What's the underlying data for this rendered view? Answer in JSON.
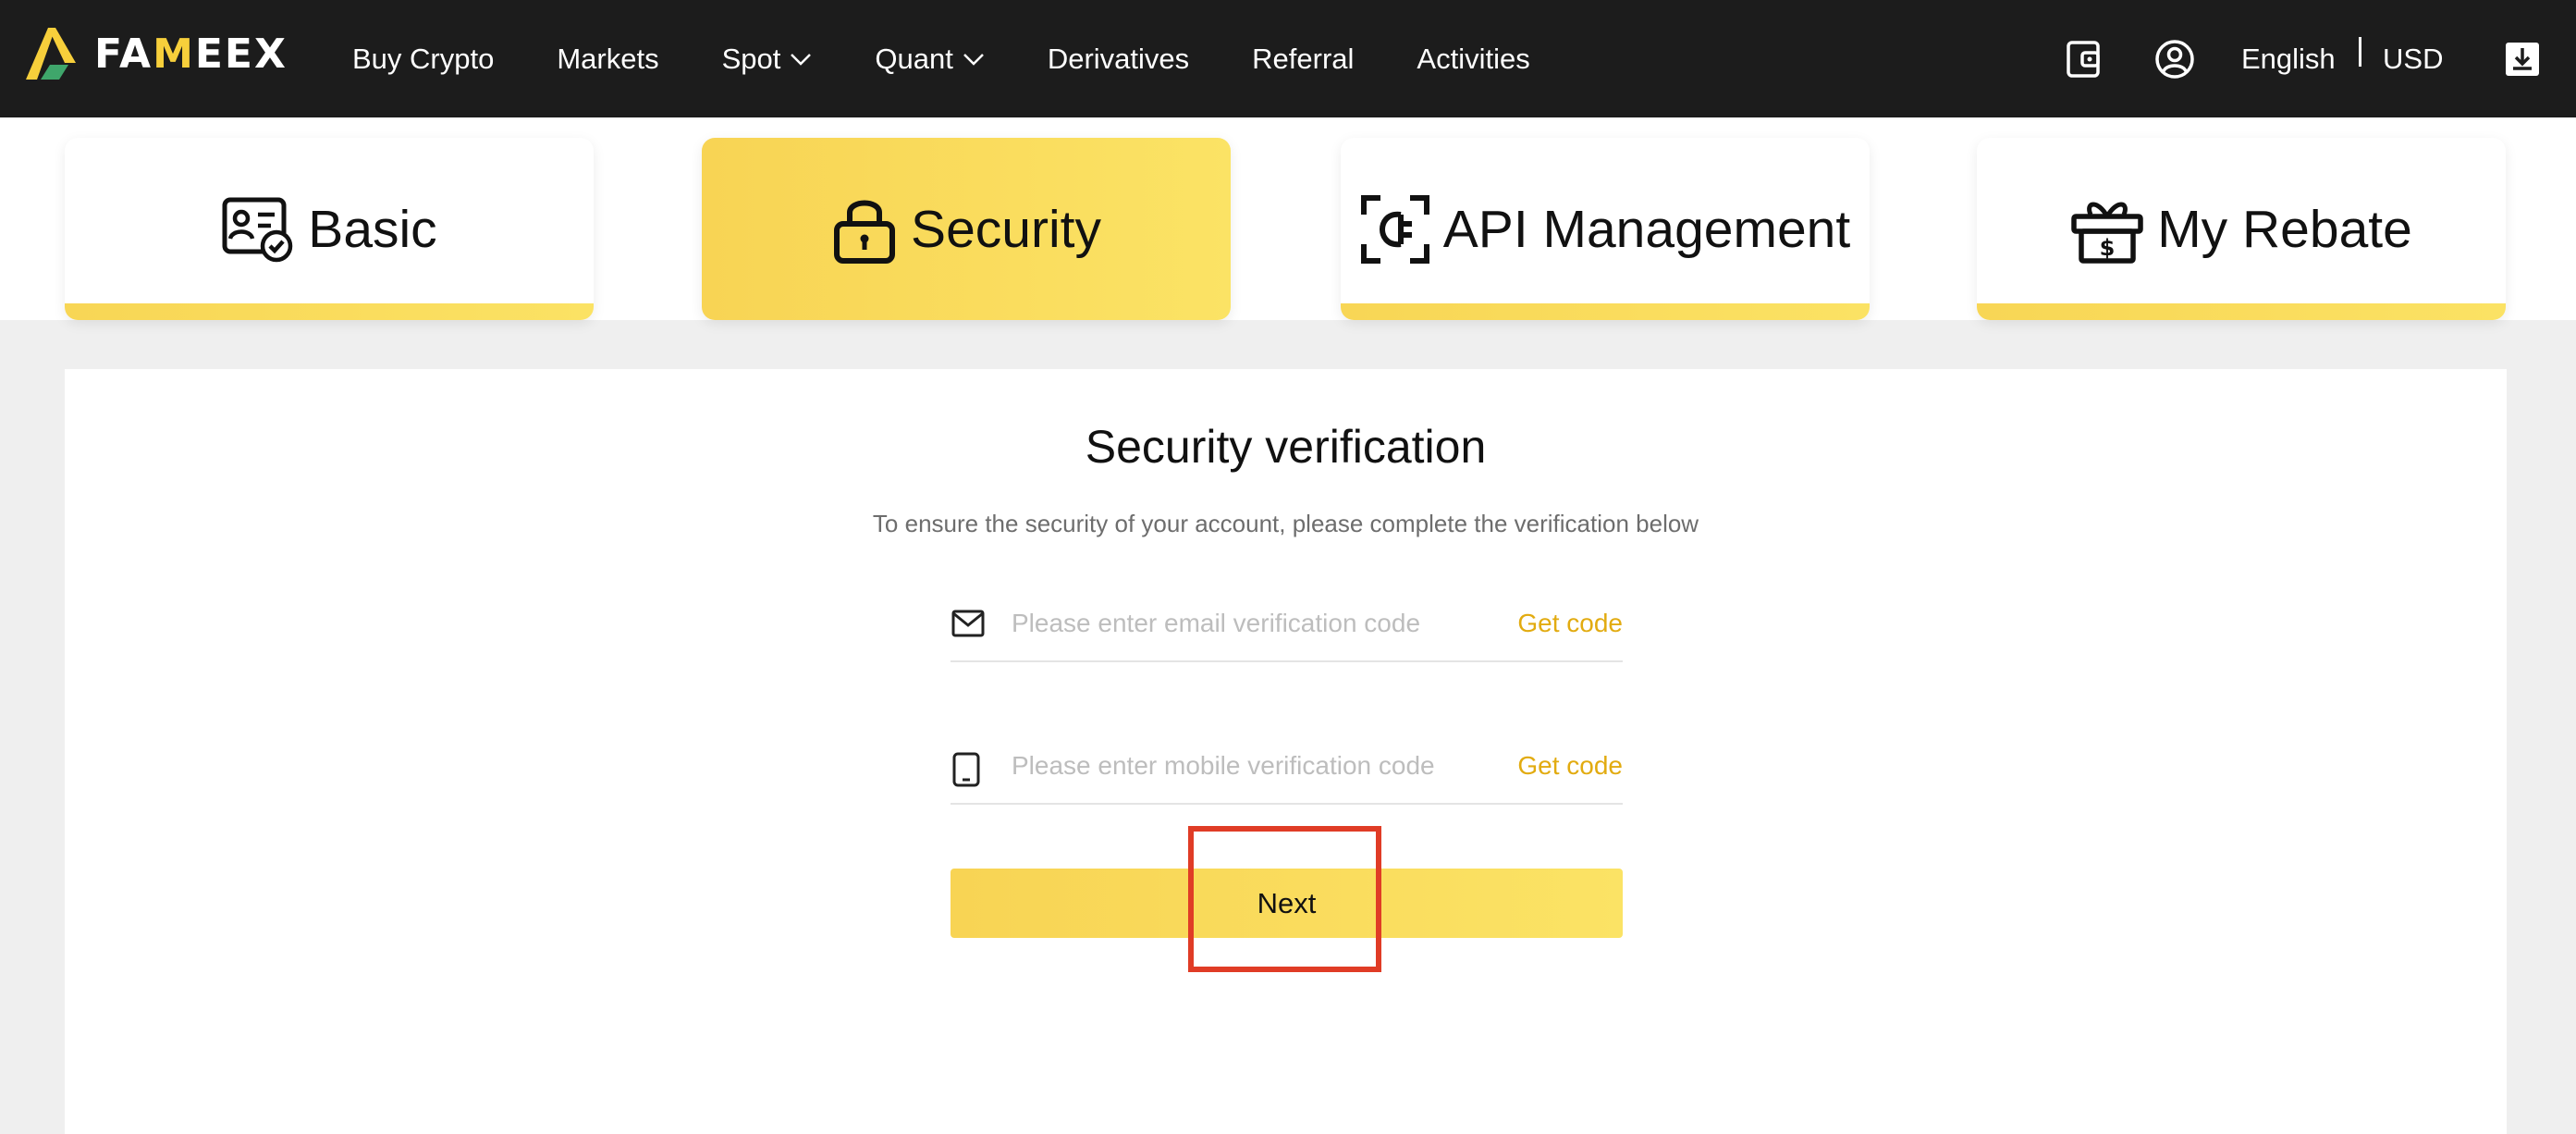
{
  "brand": {
    "logo_text_before": "FA",
    "logo_text_m": "M",
    "logo_text_after": "EEX",
    "accent": "#f7cf3b"
  },
  "nav": {
    "items": [
      {
        "label": "Buy Crypto",
        "has_dropdown": false
      },
      {
        "label": "Markets",
        "has_dropdown": false
      },
      {
        "label": "Spot",
        "has_dropdown": true
      },
      {
        "label": "Quant",
        "has_dropdown": true
      },
      {
        "label": "Derivatives",
        "has_dropdown": false
      },
      {
        "label": "Referral",
        "has_dropdown": false
      },
      {
        "label": "Activities",
        "has_dropdown": false
      }
    ],
    "language": "English",
    "currency": "USD",
    "icons": [
      "wallet-icon",
      "user-icon",
      "download-icon"
    ]
  },
  "tabs": [
    {
      "label": "Basic",
      "icon": "id-card-icon",
      "active": false
    },
    {
      "label": "Security",
      "icon": "lock-icon",
      "active": true
    },
    {
      "label": "API Management",
      "icon": "api-icon",
      "active": false
    },
    {
      "label": "My Rebate",
      "icon": "gift-icon",
      "active": false
    }
  ],
  "verification": {
    "title": "Security verification",
    "subtitle": "To ensure the security of your account, please complete the verification below",
    "email": {
      "placeholder": "Please enter email verification code",
      "action": "Get code",
      "icon": "mail-icon"
    },
    "mobile": {
      "placeholder": "Please enter mobile verification code",
      "action": "Get code",
      "icon": "phone-icon"
    },
    "next_label": "Next"
  },
  "colors": {
    "topbar": "#1c1c1c",
    "accent_yellow": "#f9d957",
    "link_gold": "#e2ab10",
    "highlight_red": "#e03c26"
  }
}
